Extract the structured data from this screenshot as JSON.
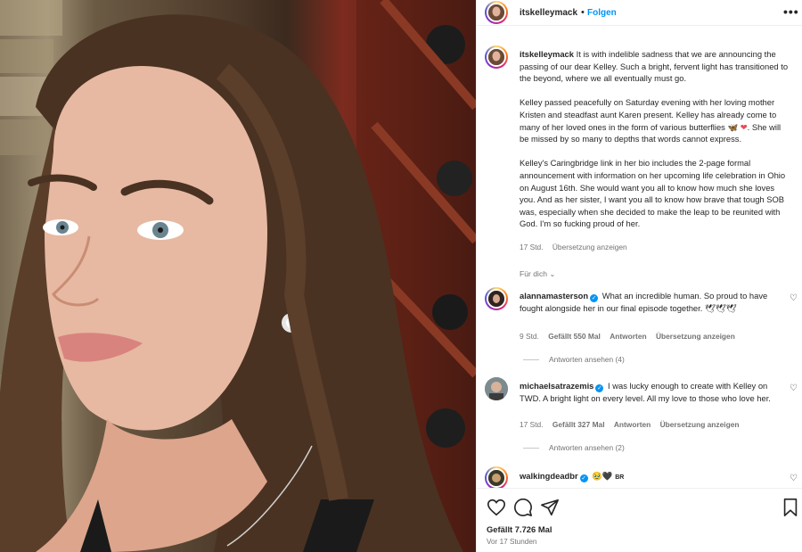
{
  "post": {
    "username": "itskelleymack",
    "separator": "•",
    "follow_label": "Folgen",
    "more_label": "•••",
    "caption_p1": "It is with indelible sadness that we are announcing the passing of our dear Kelley. Such a bright, fervent light has transitioned to the beyond, where we all eventually must go.",
    "caption_p2": "Kelley passed peacefully on Saturday evening with her loving mother Kristen and steadfast aunt Karen present. Kelley has already come to many of her loved ones in the form of various butterflies",
    "caption_p2_emoji_butterfly": "🦋",
    "caption_p2_emoji_heart": "❤",
    "caption_p2_end": ". She will be missed by so many to depths that words cannot express.",
    "caption_p3": "Kelley's Caringbridge link in her bio includes the 2-page formal announcement with information on her upcoming life celebration in Ohio on August 16th. She would want you all to know how much she loves you. And as her sister, I want you all to know how brave that tough SOB was, especially when she decided to make the leap to be reunited with God. I'm so fucking proud of her.",
    "caption_time": "17 Std.",
    "translate_label": "Übersetzung anzeigen",
    "for_you_label": "Für dich",
    "likes_label": "Gefällt 7.726 Mal",
    "posted_ago": "Vor 17 Stunden"
  },
  "comments": [
    {
      "username": "alannamasterson",
      "text": "What an incredible human. So proud to have fought alongside her in our final episode together.",
      "emoji": "🕊🕊🕊",
      "time": "9 Std.",
      "likes": "Gefällt 550 Mal",
      "reply": "Antworten",
      "translate": "Übersetzung anzeigen",
      "view_replies": "Antworten ansehen (4)"
    },
    {
      "username": "michaelsatrazemis",
      "text": "I was lucky enough to create with Kelley on TWD. A bright light on every level. All my love to those who love her.",
      "time": "17 Std.",
      "likes": "Gefällt 327 Mal",
      "reply": "Antworten",
      "translate": "Übersetzung anzeigen",
      "view_replies": "Antworten ansehen (2)"
    },
    {
      "username": "walkingdeadbr",
      "text": "🥹🖤",
      "suffix": "BR"
    }
  ],
  "icons": {
    "like": "heart-outline-icon",
    "comment": "comment-bubble-icon",
    "share": "paper-plane-icon",
    "save": "bookmark-icon",
    "comment_like": "small-heart-icon"
  },
  "colors": {
    "accent": "#0095f6",
    "text": "#262626",
    "secondary": "#737373",
    "divider": "#efefef"
  }
}
